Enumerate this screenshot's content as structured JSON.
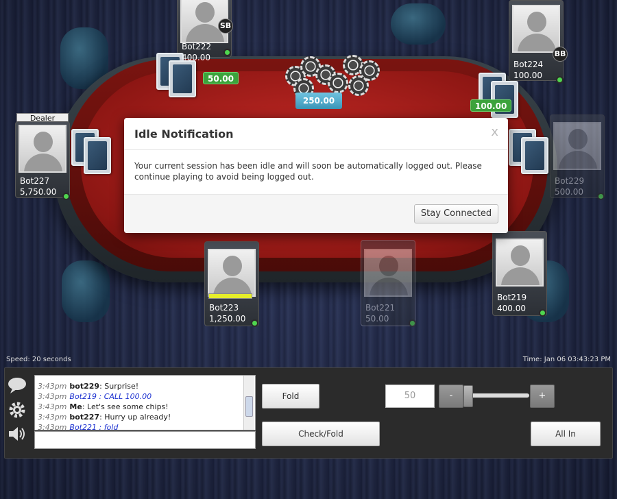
{
  "players": {
    "bot222": {
      "name": "Bot222",
      "stack": "400.00",
      "badge": "SB"
    },
    "bot224": {
      "name": "Bot224",
      "stack": "100.00",
      "badge": "BB"
    },
    "bot227": {
      "name": "Bot227",
      "stack": "5,750.00",
      "tag": "Dealer"
    },
    "bot229": {
      "name": "Bot229",
      "stack": "500.00"
    },
    "bot223": {
      "name": "Bot223",
      "stack": "1,250.00"
    },
    "bot221": {
      "name": "Bot221",
      "stack": "50.00"
    },
    "bot219": {
      "name": "Bot219",
      "stack": "400.00"
    }
  },
  "bets": {
    "sb": "50.00",
    "bb": "100.00"
  },
  "pot": "250.00",
  "modal": {
    "title": "Idle Notification",
    "close": "x",
    "message": "Your current session has been idle and will soon be automatically logged out. Please continue playing to avoid being logged out.",
    "button": "Stay Connected"
  },
  "status": {
    "speed": "Speed: 20 seconds",
    "time": "Time: Jan 06 03:43:23 PM"
  },
  "chat": {
    "lines": [
      {
        "time": "3:43pm",
        "who": "bot229",
        "text": ": Surprise!"
      },
      {
        "time": "3:43pm",
        "text": "Bot219 : CALL 100.00"
      },
      {
        "time": "3:43pm",
        "who": "Me",
        "text": ":  Let's see some chips!"
      },
      {
        "time": "3:43pm",
        "who": "bot227",
        "text": ": Hurry up already!"
      },
      {
        "time": "3:43pm",
        "text": "Bot221 : fold"
      }
    ]
  },
  "actions": {
    "fold": "Fold",
    "check_fold": "Check/Fold",
    "all_in": "All In",
    "amount": "50",
    "minus": "-",
    "plus": "+"
  },
  "icons": {
    "chat": "chat-bubble-icon",
    "settings": "gear-icon",
    "sound": "speaker-icon"
  }
}
